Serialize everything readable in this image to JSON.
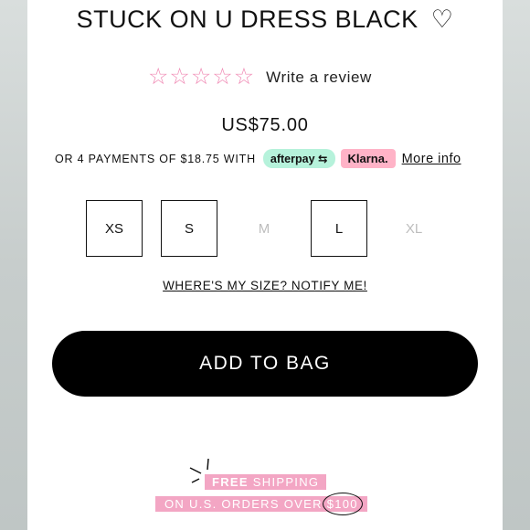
{
  "product": {
    "title": "STUCK ON U DRESS BLACK",
    "wishlist_icon": "heart-outline-icon",
    "rating": {
      "stars_filled": 0,
      "stars_total": 5,
      "write_review": "Write a review"
    },
    "price": "US$75.00"
  },
  "payments": {
    "text": "OR 4 PAYMENTS OF $18.75 WITH",
    "afterpay": "afterpay",
    "klarna": "Klarna.",
    "more_info": "More info"
  },
  "sizes": [
    {
      "label": "XS",
      "available": true
    },
    {
      "label": "S",
      "available": true
    },
    {
      "label": "M",
      "available": false
    },
    {
      "label": "L",
      "available": true
    },
    {
      "label": "XL",
      "available": false
    }
  ],
  "notify_link": "WHERE'S MY SIZE? NOTIFY ME!",
  "add_to_bag": "ADD TO BAG",
  "promo": {
    "line1_bold": "FREE",
    "line1_rest": " SHIPPING",
    "line2_prefix": "ON U.S. ORDERS OVER ",
    "line2_amount": "$100"
  },
  "colors": {
    "star": "#f08bb5",
    "afterpay_bg": "#b6f2db",
    "klarna_bg": "#ffb3c7",
    "promo_bg": "#f3a6c4",
    "button_bg": "#000000"
  }
}
